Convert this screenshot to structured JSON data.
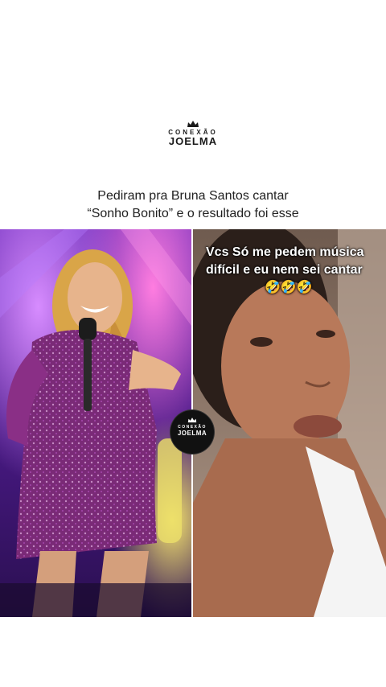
{
  "logo": {
    "line1": "CONEXÃO",
    "line2": "JOELMA"
  },
  "caption": {
    "line1": "Pediram pra Bruna Santos cantar",
    "line2": "“Sonho Bonito” e o resultado foi esse"
  },
  "video_overlay": {
    "line1": "Vcs Só me pedem música",
    "line2": "difícil e eu nem sei cantar",
    "emoji": "🤣🤣🤣"
  },
  "badge": {
    "line1": "CONEXÃO",
    "line2": "JOELMA"
  },
  "colors": {
    "stage_purple": "#6a2ab8",
    "background": "#ffffff"
  }
}
